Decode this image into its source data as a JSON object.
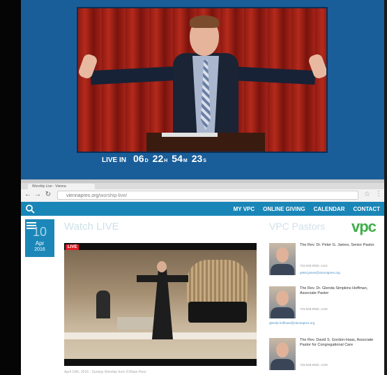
{
  "webcam": {
    "countdown_label": "LIVE IN",
    "days": "06",
    "days_unit": "D",
    "hours": "22",
    "hours_unit": "H",
    "minutes": "54",
    "minutes_unit": "M",
    "seconds": "23",
    "seconds_unit": "S"
  },
  "browser": {
    "tab_title": "Worship Live - Vienna",
    "url_domain": "viennapres.org",
    "url_path": "/worship-live/"
  },
  "site_nav": {
    "links": [
      "MY VPC",
      "ONLINE GIVING",
      "CALENDAR",
      "CONTACT"
    ]
  },
  "date": {
    "day": "10",
    "month": "Apr",
    "year": "2016"
  },
  "watch": {
    "title": "Watch LIVE",
    "live_badge": "LIVE",
    "caption": "April 10th, 2016 - Sunday Worship from 9:00am Hour"
  },
  "pastors": {
    "title": "VPC Pastors",
    "logo": "vpc",
    "items": [
      {
        "name": "The Rev. Dr. Peter G. James, Senior Pastor",
        "phone": "703.938.9050, x116",
        "email": "peter.james@viennapres.org"
      },
      {
        "name": "The Rev. Dr. Glenda Simpkins Hoffman, Associate Pastor",
        "phone": "703.938.9050, x106",
        "email": "glenda.hoffman@viennapres.org"
      },
      {
        "name": "The Rev. David S. Gordon-Haas, Associate Pastor for Congregational Care",
        "phone": "703.938.9050, x109",
        "email": ""
      }
    ]
  }
}
